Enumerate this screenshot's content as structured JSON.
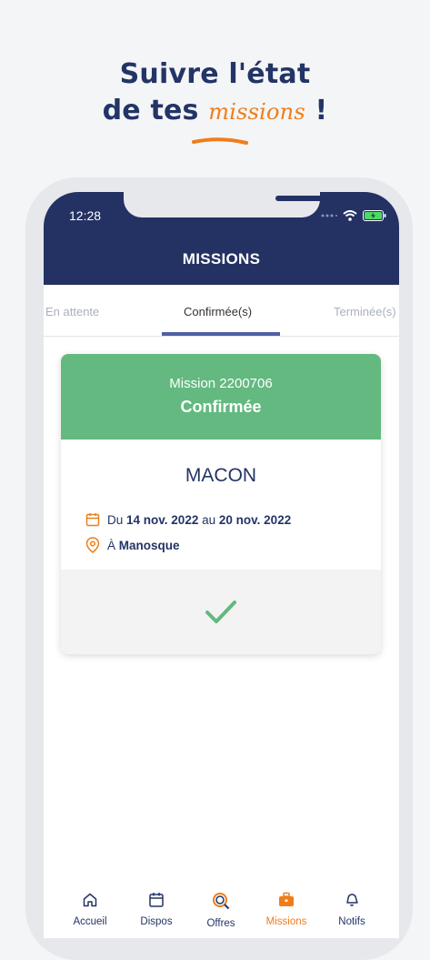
{
  "promo": {
    "line1": "Suivre l'état",
    "line2_prefix": "de tes",
    "line2_accent": "missions",
    "line2_suffix": "!"
  },
  "status_bar": {
    "time": "12:28"
  },
  "app": {
    "title": "MISSIONS"
  },
  "tabs": [
    {
      "label": "En attente"
    },
    {
      "label": "Confirmée(s)"
    },
    {
      "label": "Terminée(s)"
    }
  ],
  "mission": {
    "number": "Mission 2200706",
    "status": "Confirmée",
    "job": "MACON",
    "date_prefix": "Du",
    "date_start": "14 nov. 2022",
    "date_mid": "au",
    "date_end": "20 nov. 2022",
    "location_prefix": "À",
    "location": "Manosque"
  },
  "nav": [
    {
      "label": "Accueil",
      "icon": "home-icon"
    },
    {
      "label": "Dispos",
      "icon": "calendar-icon"
    },
    {
      "label": "Offres",
      "icon": "search-icon"
    },
    {
      "label": "Missions",
      "icon": "briefcase-icon"
    },
    {
      "label": "Notifs",
      "icon": "bell-icon"
    }
  ],
  "colors": {
    "navy": "#233163",
    "orange": "#ef7d1a",
    "green": "#63b97f"
  }
}
